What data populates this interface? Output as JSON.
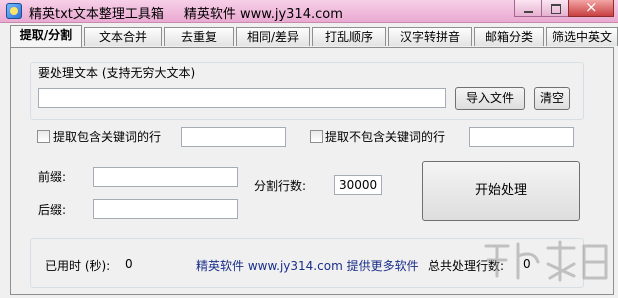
{
  "window": {
    "title": "精英txt文本整理工具箱",
    "brand": "精英软件 www.jy314.com"
  },
  "tabs": [
    {
      "label": "提取/分割",
      "active": true
    },
    {
      "label": "文本合并"
    },
    {
      "label": "去重复"
    },
    {
      "label": "相同/差异"
    },
    {
      "label": "打乱顺序"
    },
    {
      "label": "汉字转拼音"
    },
    {
      "label": "邮箱分类"
    },
    {
      "label": "筛选中英文"
    }
  ],
  "source": {
    "group_label": "要处理文本 (支持无穷大文本)",
    "path_value": "",
    "import_button": "导入文件",
    "clear_button": "清空"
  },
  "filters": {
    "include_label": "提取包含关键词的行",
    "include_checked": false,
    "include_value": "",
    "exclude_label": "提取不包含关键词的行",
    "exclude_checked": false,
    "exclude_value": ""
  },
  "affix": {
    "prefix_label": "前缀:",
    "prefix_value": "",
    "suffix_label": "后缀:",
    "suffix_value": ""
  },
  "split": {
    "label": "分割行数:",
    "value": "30000"
  },
  "start_button": "开始处理",
  "status": {
    "elapsed_label": "已用时 (秒):",
    "elapsed_value": "0",
    "promo": "精英软件 www.jy314.com 提供更多软件",
    "total_label": "总共处理行数:",
    "total_value": "0"
  },
  "colors": {
    "titlebar": "#eaa9d1",
    "promo_text": "#1a2f8a"
  }
}
